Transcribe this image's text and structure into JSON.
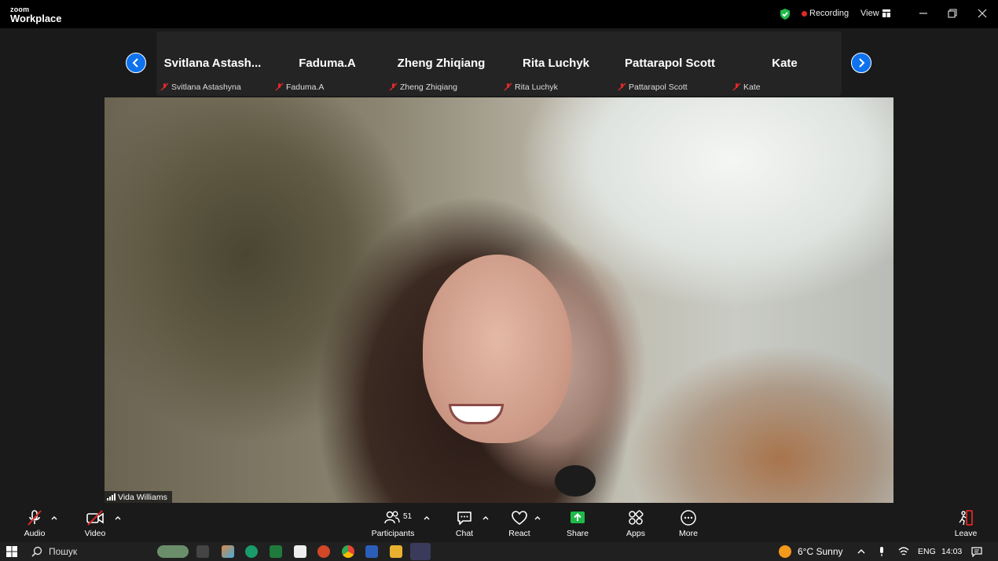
{
  "titlebar": {
    "logo_small": "zoom",
    "logo_big": "Workplace",
    "recording_label": "Recording",
    "view_label": "View"
  },
  "participants_strip": {
    "tiles": [
      {
        "name": "Svitlana  Astash...",
        "sub": "Svitlana Astashyna"
      },
      {
        "name": "Faduma.A",
        "sub": "Faduma.A"
      },
      {
        "name": "Zheng Zhiqiang",
        "sub": "Zheng Zhiqiang"
      },
      {
        "name": "Rita Luchyk",
        "sub": "Rita Luchyk"
      },
      {
        "name": "Pattarapol Scott",
        "sub": "Pattarapol Scott"
      },
      {
        "name": "Kate",
        "sub": "Kate"
      }
    ]
  },
  "main_video": {
    "speaker": "Vida Williams"
  },
  "toolbar": {
    "audio": "Audio",
    "video": "Video",
    "participants": "Participants",
    "participants_count": "51",
    "chat": "Chat",
    "react": "React",
    "share": "Share",
    "apps": "Apps",
    "more": "More",
    "leave": "Leave"
  },
  "taskbar": {
    "search_placeholder": "Пошук",
    "weather": "6°C  Sunny",
    "language": "ENG",
    "time": "14:03"
  },
  "colors": {
    "accent_blue": "#0e72ed",
    "share_green": "#1fb94a",
    "recording_red": "#e02828",
    "muted_red": "#e02828"
  },
  "icons": [
    "shield-check-icon",
    "view-grid-icon",
    "minimize-icon",
    "restore-icon",
    "close-icon",
    "chevron-left-icon",
    "chevron-right-icon",
    "mic-muted-icon",
    "video-off-icon",
    "participants-icon",
    "chat-icon",
    "react-heart-icon",
    "share-icon",
    "apps-icon",
    "more-icon",
    "leave-icon",
    "windows-start-icon",
    "search-icon",
    "signal-icon"
  ]
}
